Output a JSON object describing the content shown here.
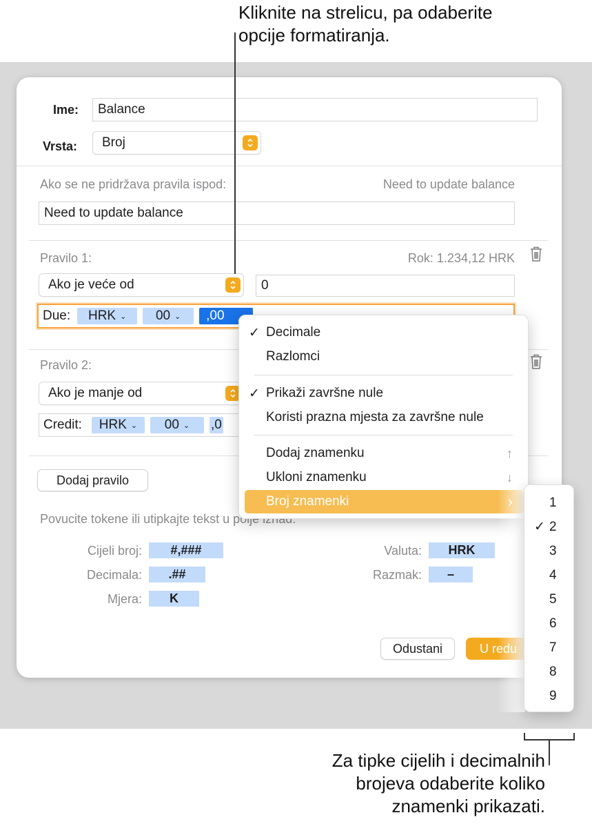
{
  "annotations": {
    "top_line1": "Kliknite na strelicu, pa odaberite",
    "top_line2": "opcije formatiranja.",
    "bottom_line1": "Za tipke cijelih i decimalnih",
    "bottom_line2": "brojeva odaberite koliko",
    "bottom_line3": "znamenki prikazati."
  },
  "dialog": {
    "name_label": "Ime:",
    "name_value": "Balance",
    "type_label": "Vrsta:",
    "type_value": "Broj",
    "noncompliance_label": "Ako se ne pridržava pravila ispod:",
    "noncompliance_preview": "Need to update balance",
    "noncompliance_value": "Need to update balance",
    "rule1": {
      "label": "Pravilo 1:",
      "preview": "Rok: 1.234,12 HRK",
      "condition": "Ako je veće od",
      "value": "0",
      "prefix": "Due:",
      "currency_token": "HRK",
      "integer_token": "00",
      "decimal_token": ",00"
    },
    "rule2": {
      "label": "Pravilo 2:",
      "condition": "Ako je manje od",
      "prefix": "Credit:",
      "currency_token": "HRK",
      "integer_token": "00",
      "decimal_token": ",0"
    },
    "add_rule_button": "Dodaj pravilo",
    "instructions": "Povucite tokene ili utipkajte tekst u polje iznad.",
    "legend": {
      "integer_label": "Cijeli broj:",
      "integer_token": "#,###",
      "decimal_label": "Decimala:",
      "decimal_token": ".##",
      "scale_label": "Mjera:",
      "scale_token": "K",
      "currency_label": "Valuta:",
      "currency_token": "HRK",
      "space_label": "Razmak:",
      "space_token": "–"
    },
    "cancel_button": "Odustani",
    "ok_button": "U redu"
  },
  "menu": {
    "decimals": "Decimale",
    "fractions": "Razlomci",
    "show_trailing_zeros": "Prikaži završne nule",
    "use_spaces_for_zeros": "Koristi prazna mjesta za završne nule",
    "add_digit": "Dodaj znamenku",
    "add_digit_shortcut": "↑",
    "remove_digit": "Ukloni znamenku",
    "remove_digit_shortcut": "↓",
    "digit_count": "Broj znamenki",
    "digit_count_arrow": "›",
    "check": "✓"
  },
  "submenu": {
    "items": [
      "1",
      "2",
      "3",
      "4",
      "5",
      "6",
      "7",
      "8",
      "9"
    ],
    "selected": "2"
  },
  "colors": {
    "accent": "#f4aa1f",
    "token": "#c3dbfb",
    "token_selected": "#1a73e8",
    "highlight": "#f7bd52"
  }
}
